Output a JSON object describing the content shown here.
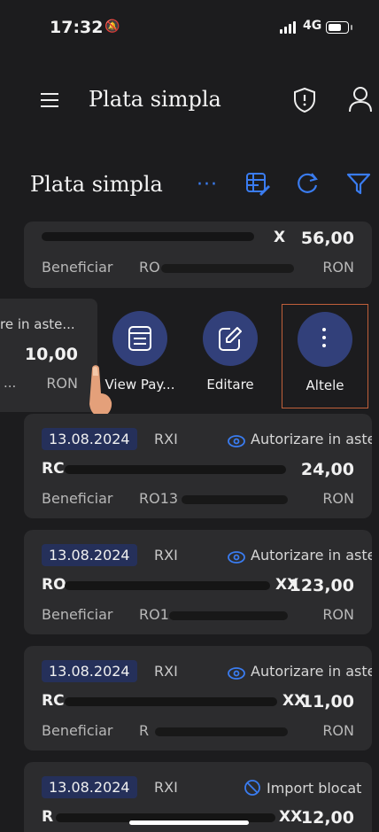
{
  "status_bar": {
    "time": "17:32",
    "network": "4G"
  },
  "header": {
    "title": "Plata simpla"
  },
  "subheader": {
    "title": "Plata simpla",
    "more": "···"
  },
  "colors": {
    "accent": "#3a7cf0",
    "chip": "#25305a",
    "action_circle": "#32407a",
    "selected_border": "#c0603a"
  },
  "icons": [
    "menu-icon",
    "shield-alert-icon",
    "user-icon",
    "more-icon",
    "grid-edit-icon",
    "refresh-icon",
    "filter-icon",
    "eye-icon",
    "blocked-icon",
    "receipt-icon",
    "edit-icon",
    "kebab-icon"
  ],
  "top_card": {
    "iban_end": "X",
    "amount": "56,00",
    "beneficiary_label": "Beneficiar",
    "beneficiary_acc": "RO",
    "currency": "RON"
  },
  "swiped_card": {
    "status": "re in aste...",
    "amount": "10,00",
    "currency": "RON",
    "ellipsis": "..."
  },
  "actions": [
    {
      "label": "View Pay..."
    },
    {
      "label": "Editare"
    },
    {
      "label": "Altele"
    }
  ],
  "payments": [
    {
      "date": "13.08.2024",
      "type": "RXI",
      "status": "Autorizare in aste...",
      "iban_start": "RC",
      "iban_end": "",
      "amount": "24,00",
      "beneficiary_label": "Beneficiar",
      "beneficiary_acc": "RO13",
      "currency": "RON"
    },
    {
      "date": "13.08.2024",
      "type": "RXI",
      "status": "Autorizare in aste...",
      "iban_start": "RO",
      "iban_end": "XX",
      "amount": "123,00",
      "beneficiary_label": "Beneficiar",
      "beneficiary_acc": "RO1",
      "currency": "RON"
    },
    {
      "date": "13.08.2024",
      "type": "RXI",
      "status": "Autorizare in aste...",
      "iban_start": "RC",
      "iban_end": "XX",
      "amount": "11,00",
      "beneficiary_label": "Beneficiar",
      "beneficiary_acc": "R",
      "currency": "RON"
    },
    {
      "date": "13.08.2024",
      "type": "RXI",
      "status": "Import blocat",
      "iban_start": "R",
      "iban_end": "XX",
      "amount": "12,00",
      "beneficiary_label": "",
      "beneficiary_acc": "",
      "currency": ""
    }
  ]
}
